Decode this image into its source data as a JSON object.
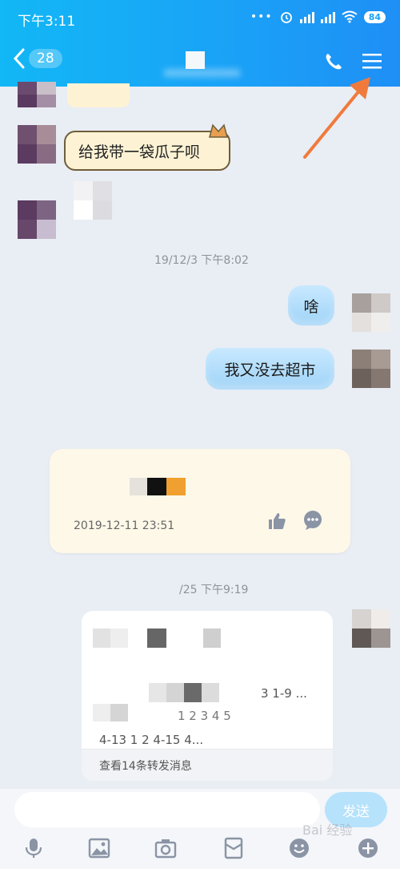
{
  "status_bar": {
    "time": "下午3:11",
    "battery": "84"
  },
  "nav": {
    "back_count": "28"
  },
  "messages": [
    {
      "type": "received",
      "text": "给我带一袋瓜子呗"
    },
    {
      "type": "timestamp",
      "text": "19/12/3 下午8:02"
    },
    {
      "type": "sent",
      "text": "啥"
    },
    {
      "type": "sent",
      "text": "我又没去超市"
    }
  ],
  "favorite_card": {
    "date": "2019-12-11 23:51"
  },
  "timestamp2": "/25 下午9:19",
  "forward_card": {
    "line1": "3 1-9 ...",
    "line2": "1 2 3  4 5",
    "line3": "4-13  1  2 4-15 4...",
    "footer": "查看14条转发消息"
  },
  "composer": {
    "placeholder": "",
    "send_label": "发送"
  },
  "watermark": "Bai 经验",
  "colors": {
    "header": "#1aa3f7",
    "sent_bubble": "#bfe4fd",
    "received_bubble": "#fdf3d4",
    "arrow": "#f07a3c"
  }
}
